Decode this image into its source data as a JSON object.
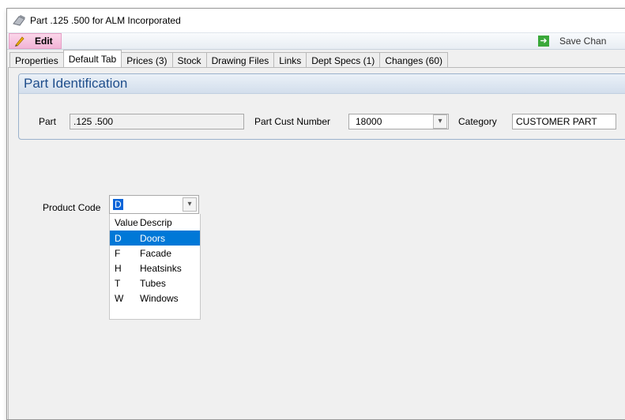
{
  "window": {
    "title": "Part .125 .500 for ALM Incorporated"
  },
  "toolbar": {
    "edit_label": "Edit",
    "save_label": "Save Chan"
  },
  "tabs": [
    {
      "label": "Properties"
    },
    {
      "label": "Default Tab"
    },
    {
      "label": "Prices (3)"
    },
    {
      "label": "Stock"
    },
    {
      "label": "Drawing Files"
    },
    {
      "label": "Links"
    },
    {
      "label": "Dept Specs (1)"
    },
    {
      "label": "Changes (60)"
    }
  ],
  "active_tab": "Default Tab",
  "part_identification": {
    "header": "Part Identification",
    "part_label": "Part",
    "part_value": ".125 .500",
    "cust_number_label": "Part Cust Number",
    "cust_number_value": "18000",
    "category_label": "Category",
    "category_value": "CUSTOMER PART"
  },
  "product_code": {
    "label": "Product Code",
    "value": "D",
    "columns": [
      "Value",
      "Descrip"
    ],
    "options": [
      {
        "value": "D",
        "descrip": "Doors"
      },
      {
        "value": "F",
        "descrip": "Facade"
      },
      {
        "value": "H",
        "descrip": "Heatsinks"
      },
      {
        "value": "T",
        "descrip": "Tubes"
      },
      {
        "value": "W",
        "descrip": "Windows"
      }
    ],
    "highlighted": "D"
  },
  "colors": {
    "selection": "#0078d7",
    "header_text": "#1f4e8c",
    "edit_bg": "#f2b4d6"
  }
}
